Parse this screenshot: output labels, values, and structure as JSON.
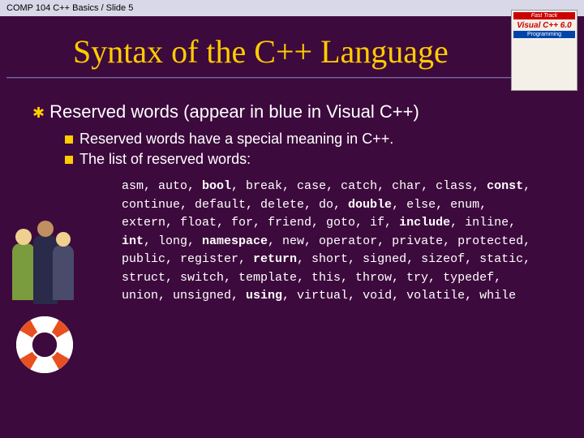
{
  "header": "COMP 104 C++ Basics / Slide 5",
  "title": "Syntax of the C++ Language",
  "bullet_main": "Reserved words (appear in blue in Visual C++)",
  "sub1": "Reserved words have a special meaning in C++.",
  "sub2": "The list of reserved words:",
  "keywords": [
    {
      "w": "asm",
      "b": 0
    },
    {
      "w": "auto",
      "b": 0
    },
    {
      "w": "bool",
      "b": 1
    },
    {
      "w": "break",
      "b": 0
    },
    {
      "w": "case",
      "b": 0
    },
    {
      "w": "catch",
      "b": 0
    },
    {
      "w": "char",
      "b": 0
    },
    {
      "w": "class",
      "b": 0
    },
    {
      "w": "const",
      "b": 1
    },
    {
      "w": "continue",
      "b": 0
    },
    {
      "w": "default",
      "b": 0
    },
    {
      "w": "delete",
      "b": 0
    },
    {
      "w": "do",
      "b": 0
    },
    {
      "w": "double",
      "b": 1
    },
    {
      "w": "else",
      "b": 0
    },
    {
      "w": "enum",
      "b": 0
    },
    {
      "w": "extern",
      "b": 0
    },
    {
      "w": "float",
      "b": 0
    },
    {
      "w": "for",
      "b": 0
    },
    {
      "w": "friend",
      "b": 0
    },
    {
      "w": "goto",
      "b": 0
    },
    {
      "w": "if",
      "b": 0
    },
    {
      "w": "include",
      "b": 1
    },
    {
      "w": "inline",
      "b": 0
    },
    {
      "w": "int",
      "b": 1
    },
    {
      "w": "long",
      "b": 0
    },
    {
      "w": "namespace",
      "b": 1
    },
    {
      "w": "new",
      "b": 0
    },
    {
      "w": "operator",
      "b": 0
    },
    {
      "w": "private",
      "b": 0
    },
    {
      "w": "protected",
      "b": 0
    },
    {
      "w": "public",
      "b": 0
    },
    {
      "w": "register",
      "b": 0
    },
    {
      "w": "return",
      "b": 1
    },
    {
      "w": "short",
      "b": 0
    },
    {
      "w": "signed",
      "b": 0
    },
    {
      "w": "sizeof",
      "b": 0
    },
    {
      "w": "static",
      "b": 0
    },
    {
      "w": "struct",
      "b": 0
    },
    {
      "w": "switch",
      "b": 0
    },
    {
      "w": "template",
      "b": 0
    },
    {
      "w": "this",
      "b": 0
    },
    {
      "w": "throw",
      "b": 0
    },
    {
      "w": "try",
      "b": 0
    },
    {
      "w": "typedef",
      "b": 0
    },
    {
      "w": "union",
      "b": 0
    },
    {
      "w": "unsigned",
      "b": 0
    },
    {
      "w": "using",
      "b": 1
    },
    {
      "w": "virtual",
      "b": 0
    },
    {
      "w": "void",
      "b": 0
    },
    {
      "w": "volatile",
      "b": 0
    },
    {
      "w": "while",
      "b": 0
    }
  ],
  "book": {
    "banner": "Fast Track",
    "title": "Visual C++ 6.0",
    "sub": "Programming"
  }
}
